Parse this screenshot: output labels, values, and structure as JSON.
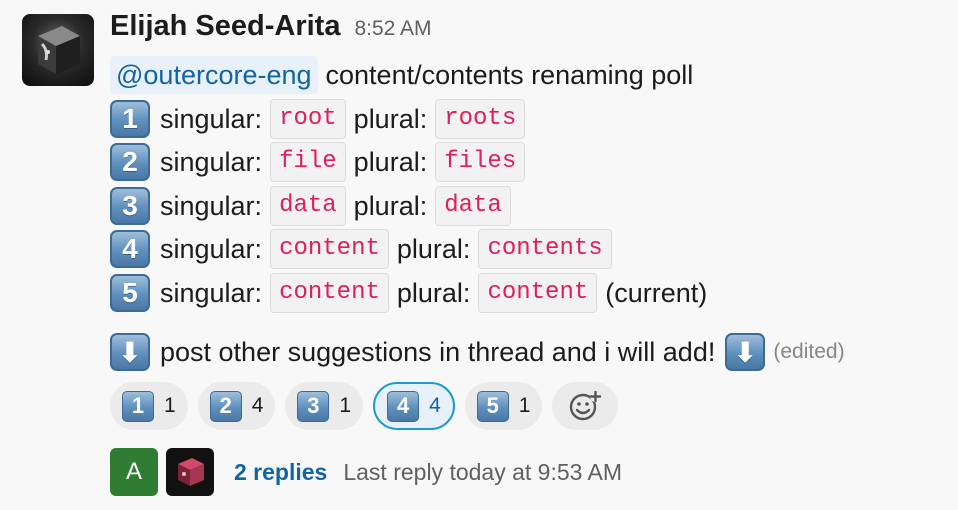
{
  "message": {
    "sender": "Elijah Seed-Arita",
    "timestamp": "8:52 AM",
    "mention": "@outercore-eng",
    "intro": "content/contents renaming poll",
    "singular_label": "singular:",
    "plural_label": "plural:",
    "options": [
      {
        "key": "1",
        "singular": "root",
        "plural": "roots",
        "suffix": ""
      },
      {
        "key": "2",
        "singular": "file",
        "plural": "files",
        "suffix": ""
      },
      {
        "key": "3",
        "singular": "data",
        "plural": "data",
        "suffix": ""
      },
      {
        "key": "4",
        "singular": "content",
        "plural": "contents",
        "suffix": ""
      },
      {
        "key": "5",
        "singular": "content",
        "plural": "content",
        "suffix": "(current)"
      }
    ],
    "closing_text": "post other suggestions in thread and i will add!",
    "arrow_icon": "⬇",
    "edited_label": "(edited)"
  },
  "reactions": [
    {
      "emoji": "1",
      "count": "1",
      "active": false
    },
    {
      "emoji": "2",
      "count": "4",
      "active": false
    },
    {
      "emoji": "3",
      "count": "1",
      "active": false
    },
    {
      "emoji": "4",
      "count": "4",
      "active": true
    },
    {
      "emoji": "5",
      "count": "1",
      "active": false
    }
  ],
  "thread": {
    "avatar_letter": "A",
    "replies": "2 replies",
    "last_reply": "Last reply today at 9:53 AM"
  },
  "colors": {
    "mention_bg": "#e8f1f9",
    "link": "#1264a3",
    "code": "#e01e5a",
    "active_border": "#1d9bd1"
  }
}
